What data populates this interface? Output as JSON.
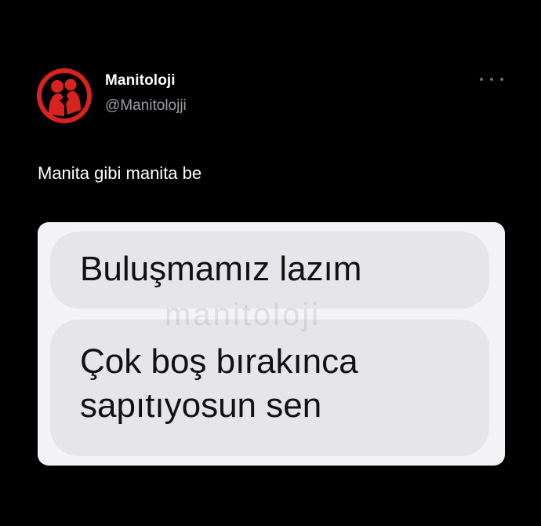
{
  "author": {
    "display_name": "Manitoloji",
    "handle": "@Manitolojji",
    "avatar_icon": "couple-silhouette-icon",
    "avatar_color": "#d8221f"
  },
  "menu": {
    "icon": "more-options-icon"
  },
  "tweet": {
    "text": "Manita gibi manita be"
  },
  "media": {
    "messages": [
      "Buluşmamız lazım",
      "Çok boş bırakınca sapıtıyosun sen"
    ],
    "watermark": "manitoloji",
    "bubble_color": "#e5e5ea"
  }
}
